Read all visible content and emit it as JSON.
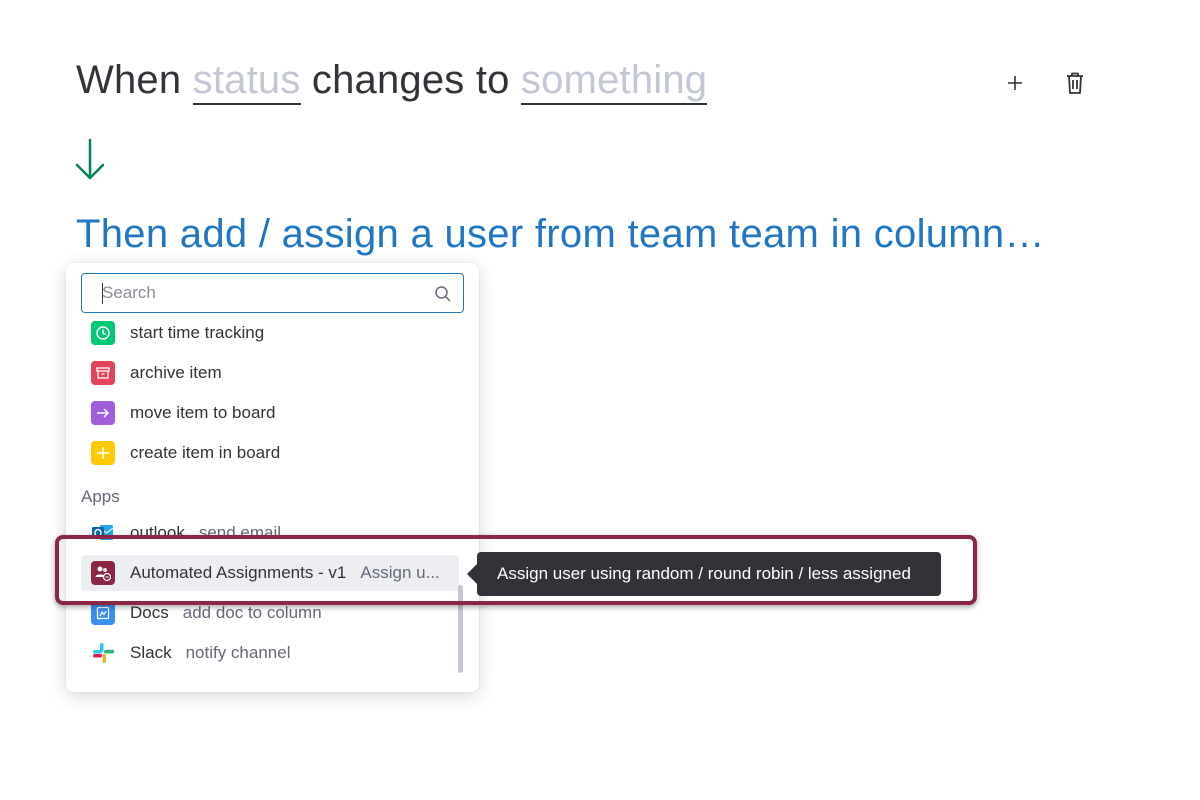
{
  "trigger": {
    "when": "When",
    "field": "status",
    "changes_to": "changes to",
    "value": "something"
  },
  "action": {
    "text": "Then add / assign a user from team team in column…"
  },
  "search": {
    "placeholder": "Search",
    "value": ""
  },
  "items": [
    {
      "label": "start time tracking",
      "icon": "clock-icon",
      "color": "#00c875"
    },
    {
      "label": "archive item",
      "icon": "archive-icon",
      "color": "#e2445c"
    },
    {
      "label": "move item to board",
      "icon": "arrow-right-icon",
      "color": "#a25ddc"
    },
    {
      "label": "create item in board",
      "icon": "plus-icon",
      "color": "#ffcb00"
    }
  ],
  "apps_section": "Apps",
  "apps": [
    {
      "name": "outlook",
      "sub": "send email",
      "icon": "outlook-icon"
    },
    {
      "name": "Automated Assignments - v1",
      "sub": "Assign u...",
      "icon": "automated-assignments-icon",
      "color": "#8b2745"
    },
    {
      "name": "Docs",
      "sub": "add doc to column",
      "icon": "docs-icon",
      "color": "#3b8ff0"
    },
    {
      "name": "Slack",
      "sub": "notify channel",
      "icon": "slack-icon"
    }
  ],
  "tooltip": "Assign user using random / round robin / less assigned",
  "colors": {
    "accent": "#1f76c2",
    "arrow": "#00854d",
    "highlight_ring": "#8b2745"
  }
}
